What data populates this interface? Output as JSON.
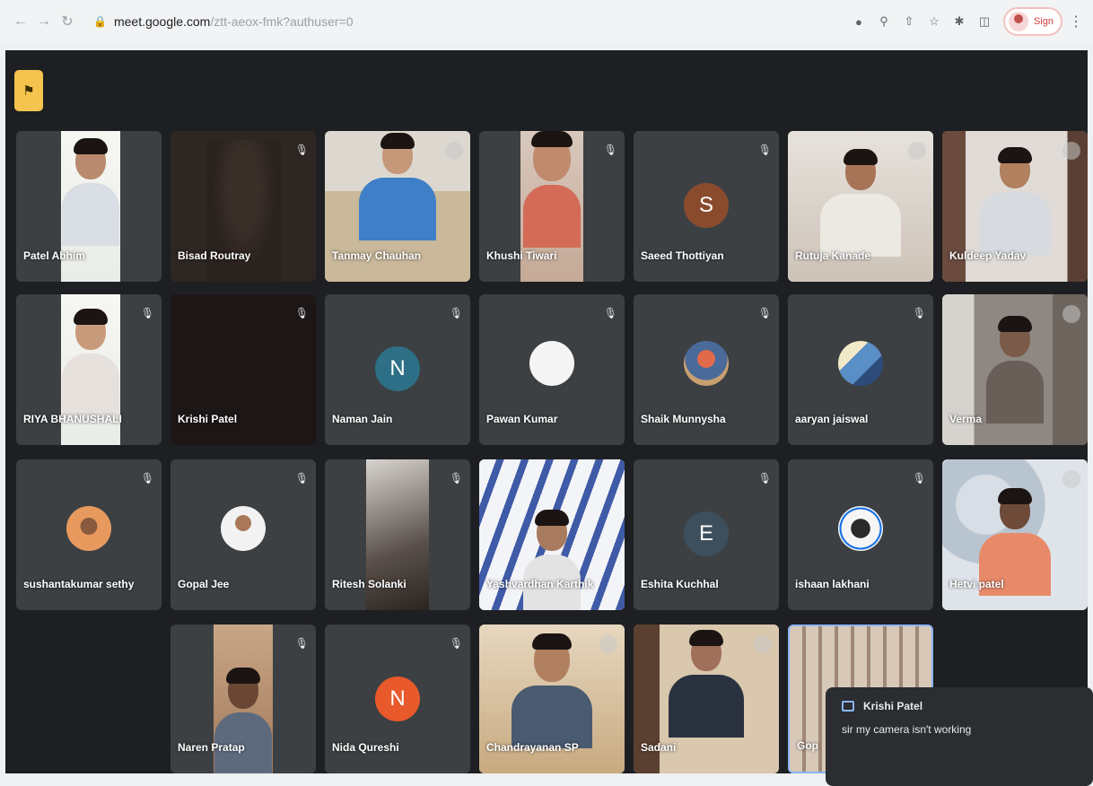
{
  "browser": {
    "url_host": "meet.google.com",
    "url_path": "/ztt-aeox-fmk?authuser=0",
    "profile_label": "Sign"
  },
  "participants": [
    {
      "name": "Patel Abhim"
    },
    {
      "name": "Bisad Routray"
    },
    {
      "name": "Tanmay Chauhan"
    },
    {
      "name": "Khushi Tiwari"
    },
    {
      "name": "Saeed Thottiyan",
      "initial": "S"
    },
    {
      "name": "Rutuja Kanade"
    },
    {
      "name": "Kuldeep Yadav"
    },
    {
      "name": "RIYA BHANUSHALI"
    },
    {
      "name": "Krishi Patel"
    },
    {
      "name": "Naman Jain",
      "initial": "N"
    },
    {
      "name": "Pawan Kumar"
    },
    {
      "name": "Shaik Munnysha"
    },
    {
      "name": "aaryan jaiswal"
    },
    {
      "name": "Verma"
    },
    {
      "name": "sushantakumar sethy"
    },
    {
      "name": "Gopal Jee"
    },
    {
      "name": "Ritesh Solanki"
    },
    {
      "name": "Yashvardhan Karthik"
    },
    {
      "name": "Eshita Kuchhal",
      "initial": "E"
    },
    {
      "name": "ishaan lakhani"
    },
    {
      "name": "Hetvi patel"
    },
    {
      "name": "Naren Pratap"
    },
    {
      "name": "Nida Qureshi",
      "initial": "N"
    },
    {
      "name": "Chandrayanan SP"
    },
    {
      "name": "Sadani"
    },
    {
      "name": "Gop"
    }
  ],
  "chat": {
    "sender": "Krishi Patel",
    "message": "sir my camera isn't working"
  },
  "colors": {
    "meet_bg": "#1e1f22",
    "tile_bg": "#3c4043",
    "host_badge": "#f4c44e",
    "avatar_s": "#8a4b2d",
    "avatar_n1": "#2d6f86",
    "avatar_e": "#3d4f5c",
    "avatar_n2": "#e8592b"
  }
}
